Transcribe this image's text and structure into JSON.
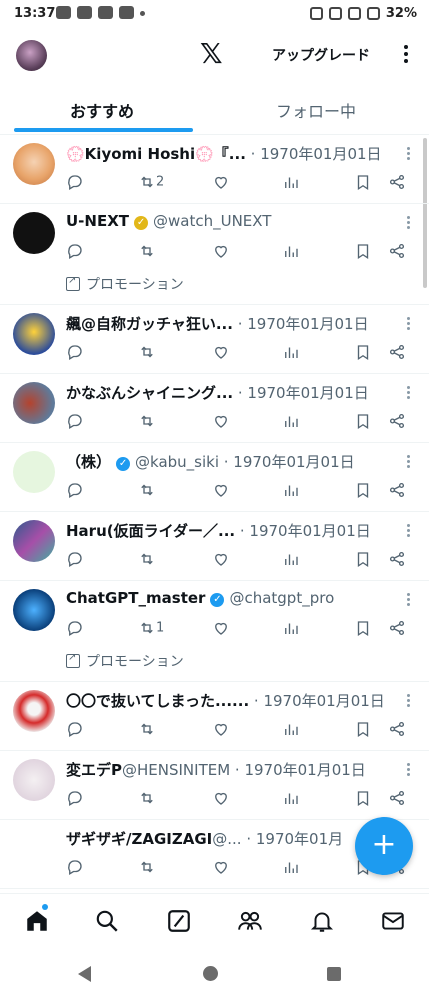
{
  "status": {
    "time": "13:37",
    "battery": "32%"
  },
  "top": {
    "upgrade": "アップグレード",
    "logo": "𝕏"
  },
  "tabs": [
    {
      "label": "おすすめ"
    },
    {
      "label": "フォロー中"
    }
  ],
  "posts": [
    {
      "name": "💮Kiyomi Hoshi💮『...",
      "meta": " · 1970年01月01日",
      "retweets": "2",
      "promo": ""
    },
    {
      "name": "U-NEXT",
      "meta": "@watch_UNEXT",
      "verified": "gold",
      "promo": "プロモーション"
    },
    {
      "name": "飆@自称ガッチャ狂い...",
      "meta": " · 1970年01月01日",
      "promo": ""
    },
    {
      "name": "かなぶんシャイニング...",
      "meta": " · 1970年01月01日",
      "promo": ""
    },
    {
      "name": "（株）",
      "meta": "@kabu_siki · 1970年01月01日",
      "verified": "blue",
      "promo": ""
    },
    {
      "name": "Haru(仮面ライダー／...",
      "meta": " · 1970年01月01日",
      "promo": ""
    },
    {
      "name": "ChatGPT_master",
      "meta": "@chatgpt_pro",
      "verified": "blue",
      "retweets": "1",
      "promo": "プロモーション"
    },
    {
      "name": "〇〇で抜いてしまった......",
      "meta": " · 1970年01月01日",
      "promo": ""
    },
    {
      "name": "変エデP",
      "meta": "@HENSINITEM · 1970年01月01日",
      "promo": ""
    },
    {
      "name": "ザギザギ/ZAGIZAGI",
      "meta": "@... · 1970年01月",
      "promo": ""
    }
  ],
  "colors": {
    "accent": "#1d9bf0",
    "gold": "#e2b719"
  },
  "icons": {
    "actions": [
      "reply-icon",
      "retweet-icon",
      "like-icon",
      "views-icon",
      "bookmark-icon",
      "share-icon"
    ],
    "nav": [
      "home-icon",
      "search-icon",
      "grok-icon",
      "communities-icon",
      "notifications-icon",
      "messages-icon"
    ]
  }
}
